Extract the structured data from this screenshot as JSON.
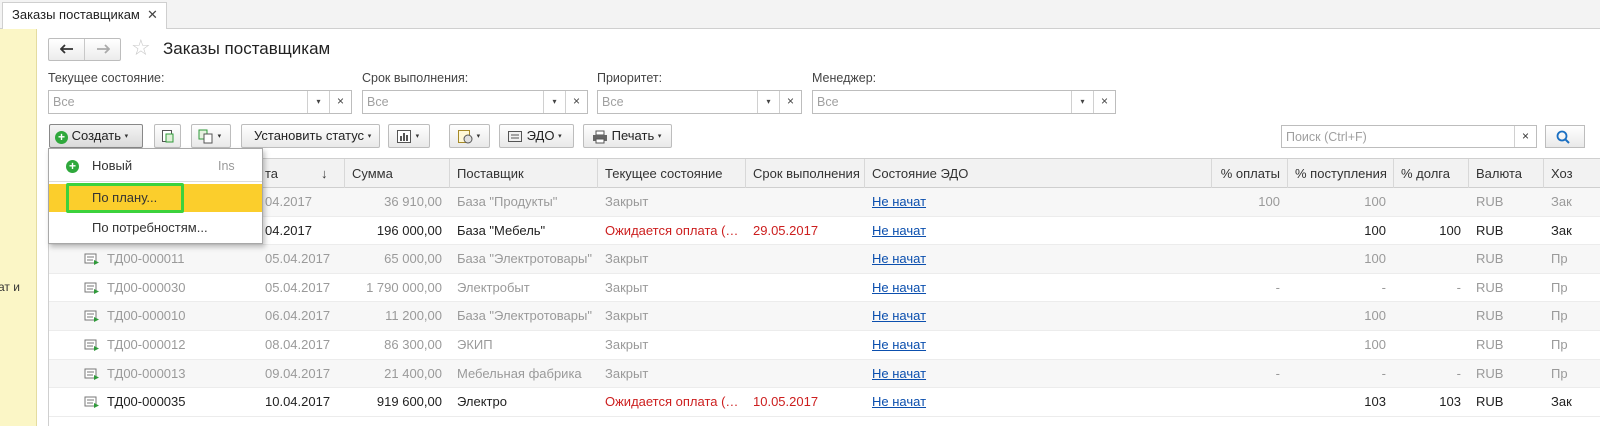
{
  "tabstrip": {
    "tab_label": "Заказы поставщикам",
    "close_glyph": "✕"
  },
  "left_panel": {
    "text": "ат и"
  },
  "header": {
    "title": "Заказы поставщикам",
    "back_glyph": "🡐",
    "forward_glyph": "🡒",
    "favorite_glyph": "☆"
  },
  "filters": [
    {
      "label": "Текущее состояние:",
      "value": "Все"
    },
    {
      "label": "Срок выполнения:",
      "value": "Все"
    },
    {
      "label": "Приоритет:",
      "value": "Все"
    },
    {
      "label": "Менеджер:",
      "value": "Все"
    }
  ],
  "glyphs": {
    "dropdown": "▾",
    "clear": "×"
  },
  "toolbar": {
    "create_label": "Создать",
    "set_status_label": "Установить статус",
    "edo_label": "ЭДО",
    "print_label": "Печать",
    "search_placeholder": "Поиск (Ctrl+F)"
  },
  "create_menu": {
    "items": [
      {
        "label": "Новый",
        "shortcut": "Ins"
      },
      {
        "label": "По плану..."
      },
      {
        "label": "По потребностям..."
      }
    ]
  },
  "table": {
    "columns": [
      "Дата",
      "Сумма",
      "Поставщик",
      "Текущее состояние",
      "Срок выполнения",
      "Состояние ЭДО",
      "% оплаты",
      "% поступления",
      "% долга",
      "Валюта",
      "Хоз"
    ],
    "date_header_partial": "та",
    "sort_glyph": "↓",
    "rows": [
      {
        "number": "",
        "date": "04.2017",
        "sum": "36 910,00",
        "supplier": "База \"Продукты\"",
        "state": "Закрыт",
        "due": "",
        "edo": "Не начат",
        "paid": "100",
        "received": "100",
        "debt": "",
        "currency": "RUB",
        "extra": "Зак"
      },
      {
        "number": "",
        "date": "04.2017",
        "sum": "196 000,00",
        "supplier": "База \"Мебель\"",
        "state": "Ожидается оплата (…",
        "due": "29.05.2017",
        "edo": "Не начат",
        "paid": "",
        "received": "100",
        "debt": "100",
        "currency": "RUB",
        "extra": "Зак"
      },
      {
        "number": "ТД00-000011",
        "date": "05.04.2017",
        "sum": "65 000,00",
        "supplier": "База \"Электротовары\"",
        "state": "Закрыт",
        "due": "",
        "edo": "Не начат",
        "paid": "",
        "received": "100",
        "debt": "",
        "currency": "RUB",
        "extra": "Пр"
      },
      {
        "number": "ТД00-000030",
        "date": "05.04.2017",
        "sum": "1 790 000,00",
        "supplier": "Электробыт",
        "state": "Закрыт",
        "due": "",
        "edo": "Не начат",
        "paid": "-",
        "received": "-",
        "debt": "-",
        "currency": "RUB",
        "extra": "Пр"
      },
      {
        "number": "ТД00-000010",
        "date": "06.04.2017",
        "sum": "11 200,00",
        "supplier": "База \"Электротовары\"",
        "state": "Закрыт",
        "due": "",
        "edo": "Не начат",
        "paid": "",
        "received": "100",
        "debt": "",
        "currency": "RUB",
        "extra": "Пр"
      },
      {
        "number": "ТД00-000012",
        "date": "08.04.2017",
        "sum": "86 300,00",
        "supplier": "ЭКИП",
        "state": "Закрыт",
        "due": "",
        "edo": "Не начат",
        "paid": "",
        "received": "100",
        "debt": "",
        "currency": "RUB",
        "extra": "Пр"
      },
      {
        "number": "ТД00-000013",
        "date": "09.04.2017",
        "sum": "21 400,00",
        "supplier": "Мебельная фабрика",
        "state": "Закрыт",
        "due": "",
        "edo": "Не начат",
        "paid": "-",
        "received": "-",
        "debt": "-",
        "currency": "RUB",
        "extra": "Пр"
      },
      {
        "number": "ТД00-000035",
        "date": "10.04.2017",
        "sum": "919 600,00",
        "supplier": "Электро",
        "state": "Ожидается оплата (…",
        "due": "10.05.2017",
        "edo": "Не начат",
        "paid": "",
        "received": "103",
        "debt": "103",
        "currency": "RUB",
        "extra": "Зак"
      }
    ]
  },
  "icons": [
    "back-arrow-icon",
    "forward-arrow-icon",
    "star-icon",
    "plus-icon",
    "copy-icon",
    "structure-icon",
    "report-icon",
    "task-icon",
    "edo-icon",
    "printer-icon",
    "search-icon",
    "document-icon"
  ],
  "colors": {
    "accent_yellow": "#fbce2c",
    "highlight_green": "#3cd23c",
    "link_blue": "#0b4fae",
    "status_red": "#cc1e1e",
    "panel_yellow": "#fbf6c6"
  }
}
